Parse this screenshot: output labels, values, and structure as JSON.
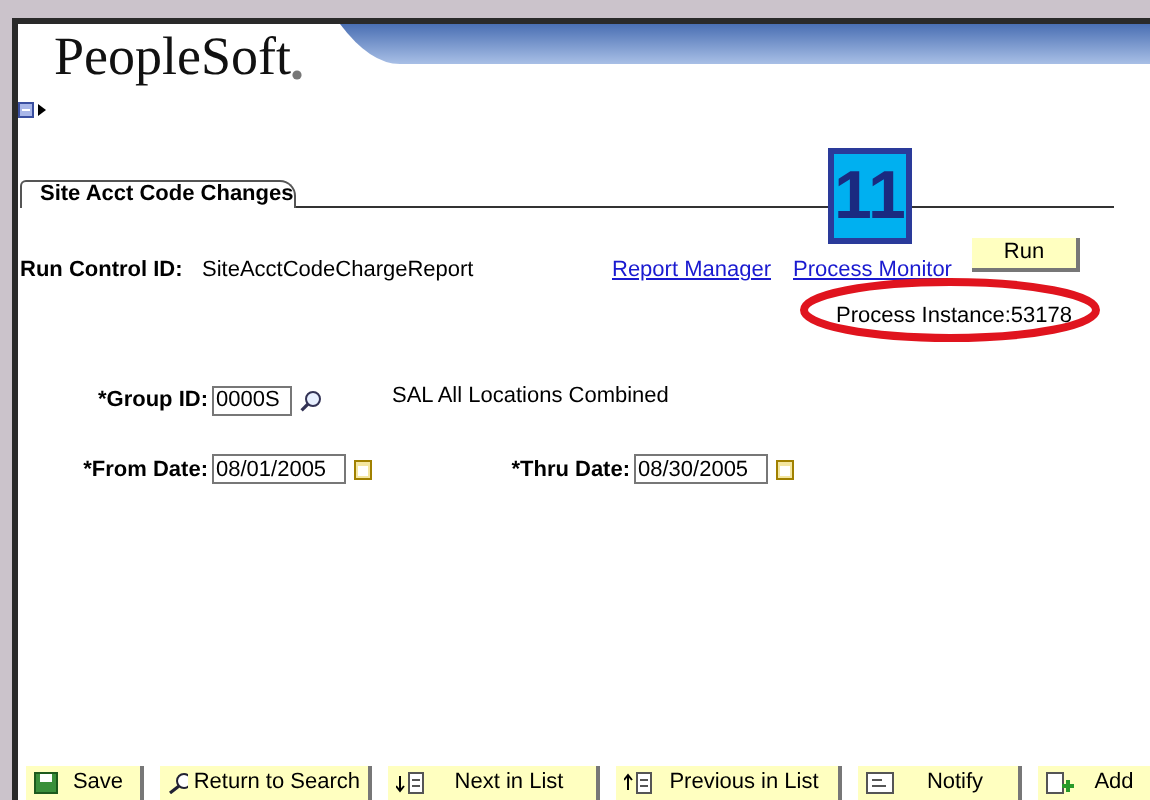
{
  "header": {
    "logo": "PeopleSoft"
  },
  "tab": {
    "label": "Site Acct Code Changes"
  },
  "step_badge": "11",
  "run_control": {
    "label": "Run Control ID:",
    "value": "SiteAcctCodeChargeReport"
  },
  "links": [
    "Report Manager",
    "Process Monitor"
  ],
  "run_button": "Run",
  "process_instance": "Process Instance:53178",
  "fields": [
    {
      "kind": "lookup",
      "label": "*Group ID:",
      "value": "0000S",
      "description": "SAL All Locations Combined"
    },
    {
      "kind": "date",
      "label": "*From Date:",
      "value": "08/01/2005"
    },
    {
      "kind": "date",
      "label": "*Thru Date:",
      "value": "08/30/2005"
    }
  ],
  "toolbar": [
    {
      "kind": "save",
      "label": "Save"
    },
    {
      "kind": "search",
      "label": "Return to Search"
    },
    {
      "kind": "next",
      "label": "Next in List"
    },
    {
      "kind": "previous",
      "label": "Previous in List"
    },
    {
      "kind": "notify",
      "label": "Notify"
    },
    {
      "kind": "add",
      "label": "Add"
    }
  ]
}
